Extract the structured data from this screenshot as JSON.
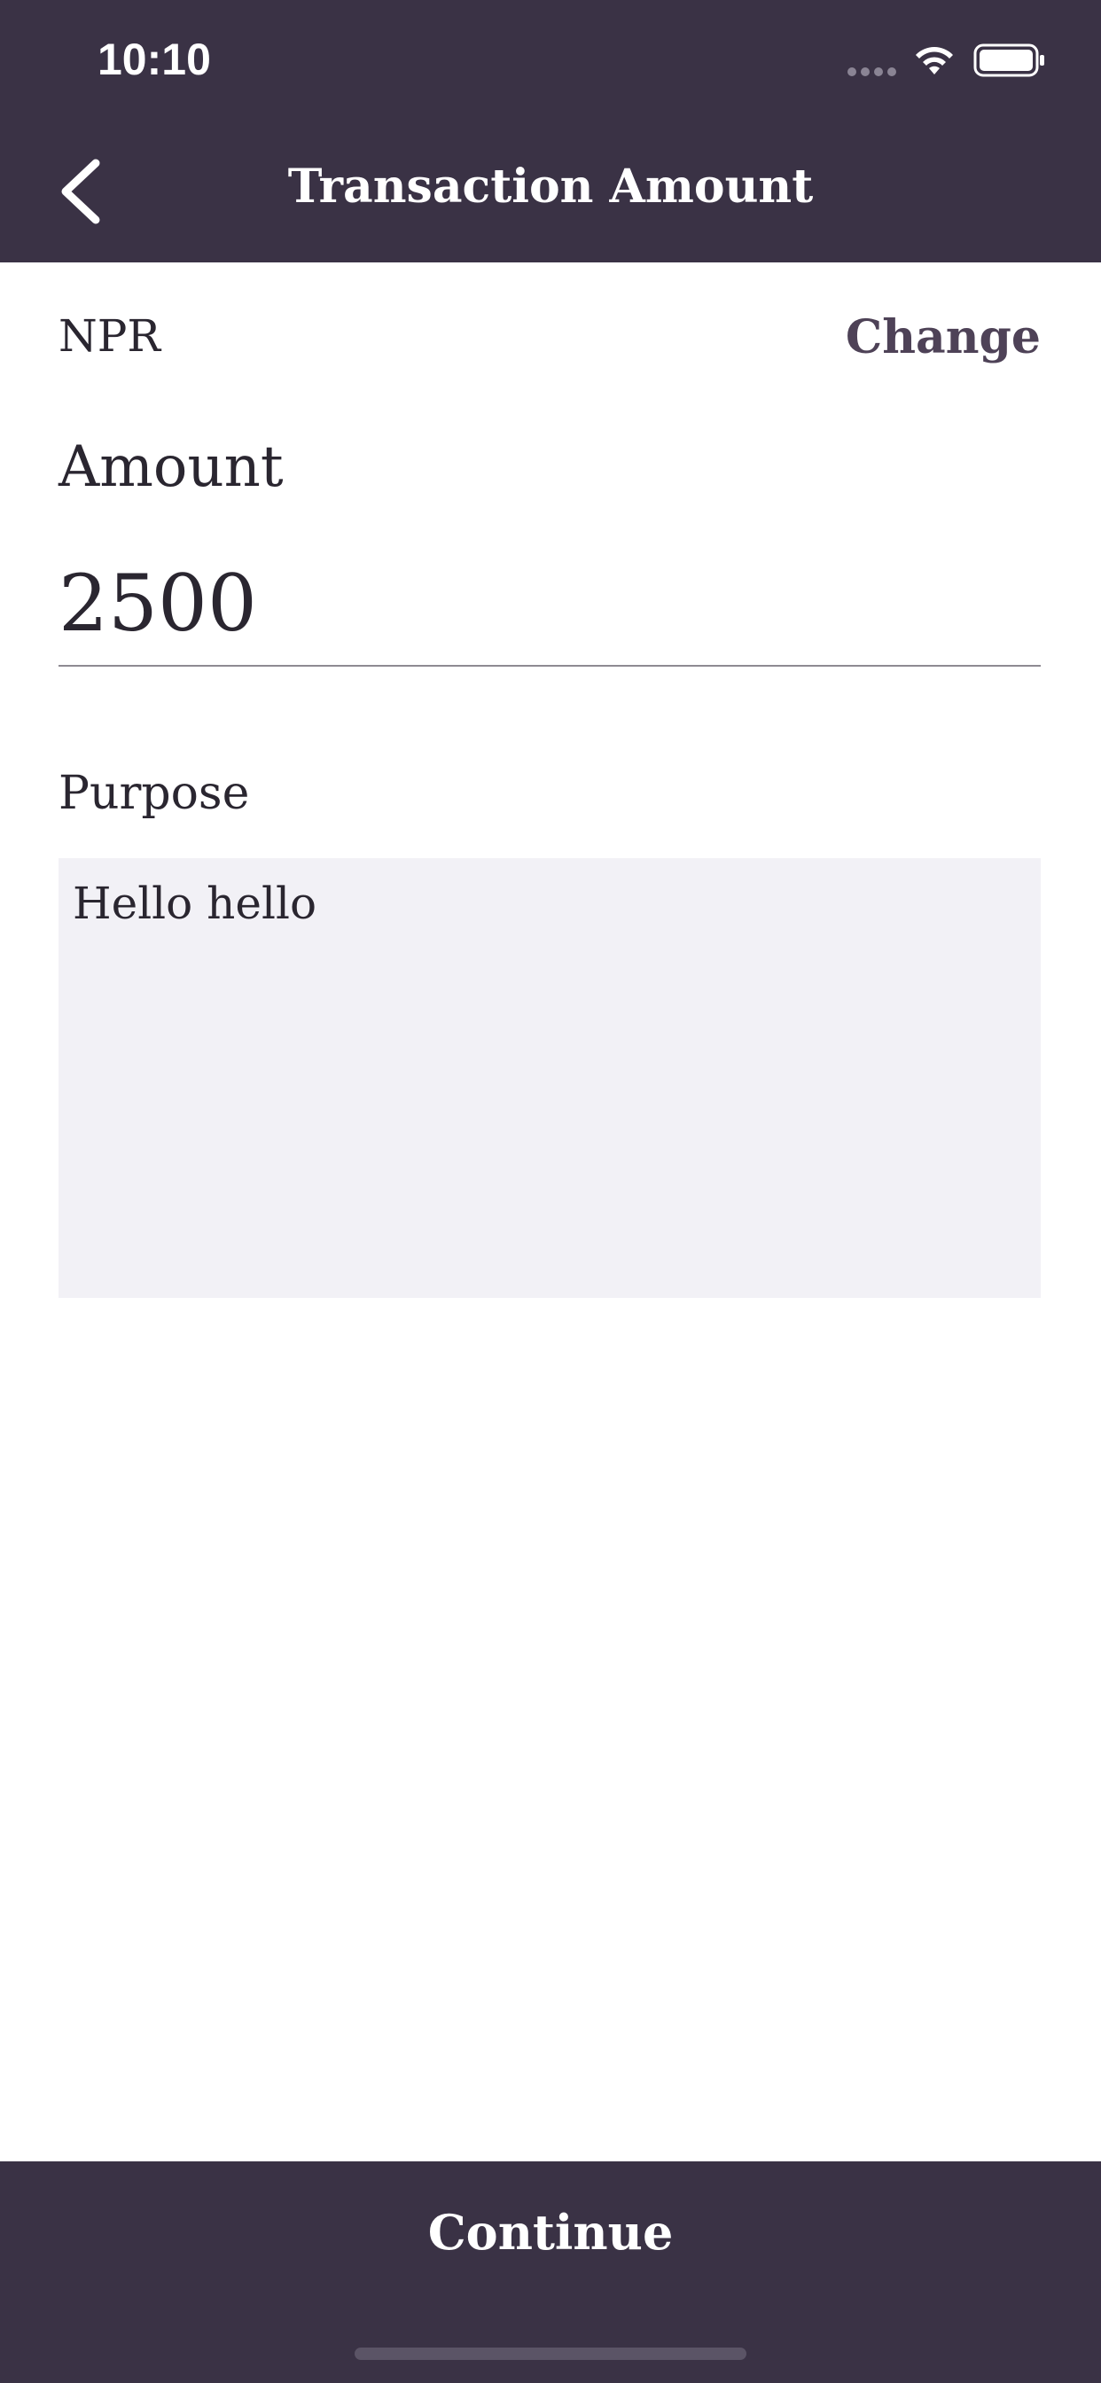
{
  "status_bar": {
    "time": "10:10"
  },
  "nav": {
    "title": "Transaction Amount",
    "back_icon": "chevron-left-icon"
  },
  "currency": {
    "code": "NPR",
    "change_label": "Change"
  },
  "amount": {
    "label": "Amount",
    "value": "2500"
  },
  "purpose": {
    "label": "Purpose",
    "value": "Hello hello"
  },
  "footer": {
    "continue_label": "Continue"
  },
  "colors": {
    "primary": "#3a3245",
    "accent": "#4e4257",
    "input_bg": "#f2f1f6"
  }
}
